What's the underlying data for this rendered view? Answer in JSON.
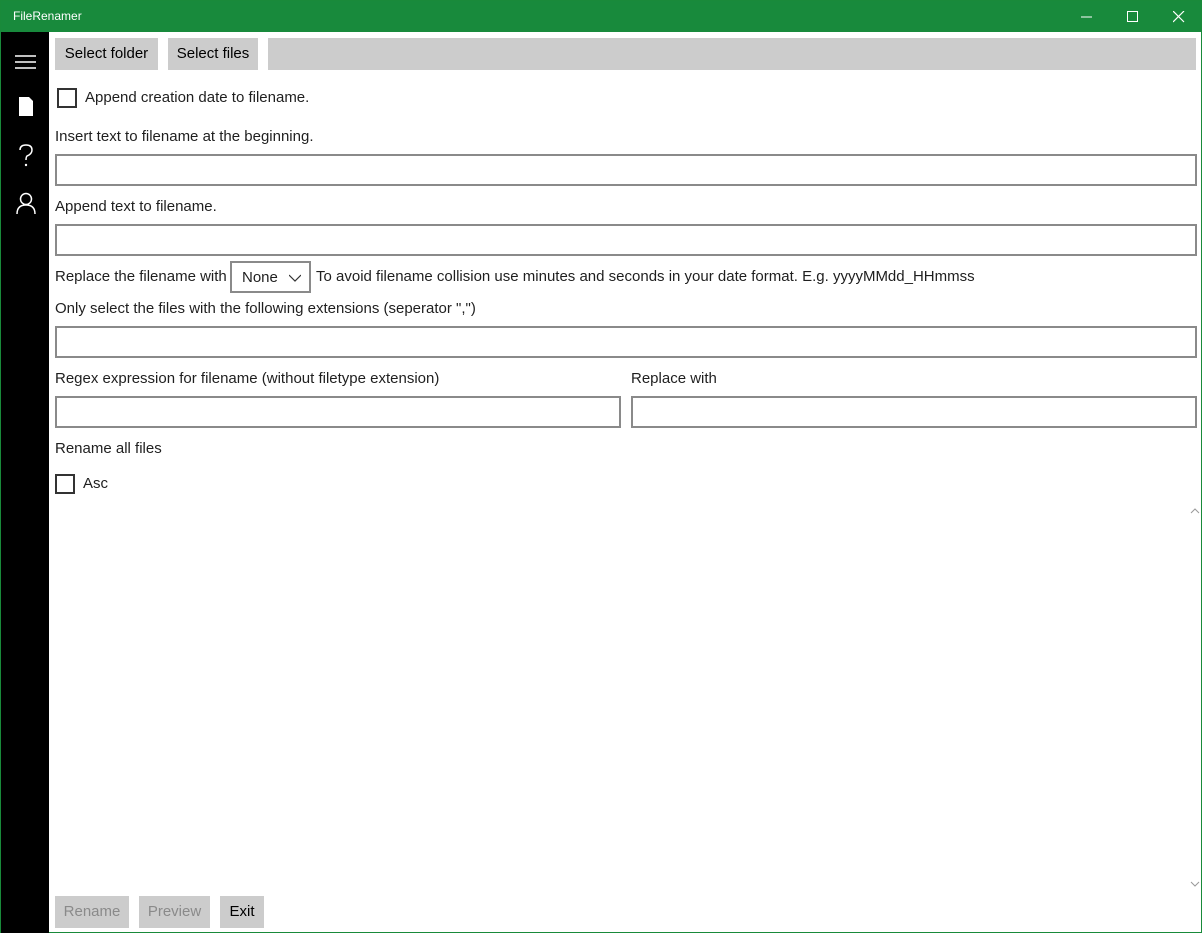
{
  "window": {
    "title": "FileRenamer"
  },
  "nav": {
    "items": [
      "hamburger-menu-icon",
      "document-icon",
      "help-icon",
      "account-icon"
    ]
  },
  "toolbar": {
    "select_folder": "Select folder",
    "select_files": "Select files"
  },
  "options": {
    "append_date_label": "Append creation date to filename.",
    "insert_text_label": "Insert text to filename at the beginning.",
    "insert_text_value": "",
    "append_text_label": "Append text to filename.",
    "append_text_value": "",
    "replace_filename_label": "Replace the filename with",
    "replace_filename_value": "None",
    "collision_hint": "To avoid filename collision use minutes and seconds in your date format. E.g. yyyyMMdd_HHmmss",
    "extensions_label": "Only select the files with the following extensions (seperator \",\")",
    "extensions_value": "",
    "regex_label": "Regex expression for filename (without filetype extension)",
    "regex_value": "",
    "replace_with_label": "Replace with",
    "replace_with_value": "",
    "rename_all_label": "Rename all files",
    "asc_label": "Asc"
  },
  "actions": {
    "rename": "Rename",
    "preview": "Preview",
    "exit": "Exit"
  },
  "colors": {
    "titlebar": "#188a3c",
    "nav": "#000000",
    "button": "#cccccc"
  }
}
